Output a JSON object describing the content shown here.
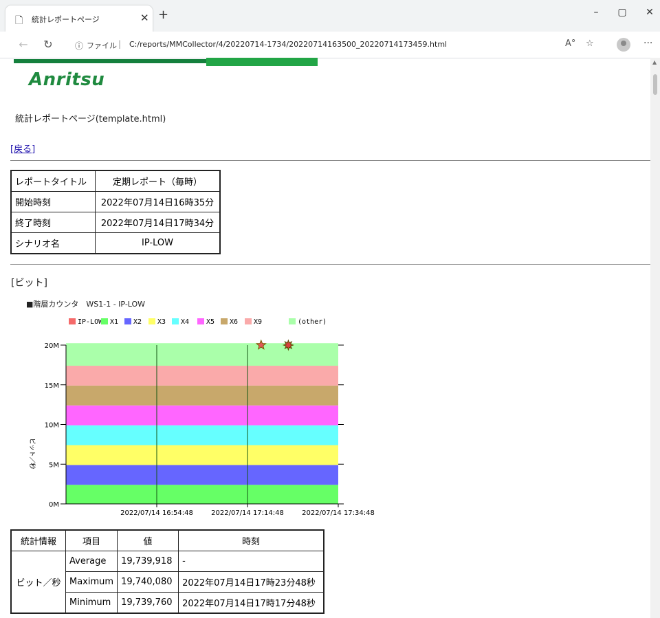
{
  "browser": {
    "tab_title": "統計レポートページ",
    "url_label": "ファイル",
    "url": "C:/reports/MMCollector/4/20220714-1734/20220714163500_20220714173459.html"
  },
  "page": {
    "logo": "Anritsu",
    "title": "統計レポートページ(template.html)",
    "back_link": "[戻る]"
  },
  "report_info": [
    {
      "label": "レポートタイトル",
      "value": "定期レポート（毎時）"
    },
    {
      "label": "開始時刻",
      "value": "2022年07月14日16時35分"
    },
    {
      "label": "終了時刻",
      "value": "2022年07月14日17時34分"
    },
    {
      "label": "シナリオ名",
      "value": "IP-LOW"
    }
  ],
  "section_title": "[ビット]",
  "chart_heading": "■階層カウンタ　WS1-1 - IP-LOW",
  "chart_data": {
    "type": "area",
    "stacked": true,
    "ylabel": "ビット／秒",
    "ylim": [
      0,
      20000000
    ],
    "yticks": [
      "0M",
      "5M",
      "10M",
      "15M",
      "20M"
    ],
    "xticks": [
      "2022/07/14 16:54:48",
      "2022/07/14 17:14:48",
      "2022/07/14 17:34:48"
    ],
    "series": [
      {
        "name": "IP-LOW",
        "color": "#f56a6a",
        "values": [
          0,
          0
        ]
      },
      {
        "name": "X1",
        "color": "#66ff66",
        "values": [
          2400000,
          2400000
        ]
      },
      {
        "name": "X2",
        "color": "#6666ff",
        "values": [
          2500000,
          2500000
        ]
      },
      {
        "name": "X3",
        "color": "#ffff66",
        "values": [
          2500000,
          2500000
        ]
      },
      {
        "name": "X4",
        "color": "#66ffff",
        "values": [
          2500000,
          2500000
        ]
      },
      {
        "name": "X5",
        "color": "#ff66ff",
        "values": [
          2500000,
          2500000
        ]
      },
      {
        "name": "X6",
        "color": "#c8a86b",
        "values": [
          2500000,
          2500000
        ]
      },
      {
        "name": "X9",
        "color": "#faaaaa",
        "values": [
          2500000,
          2500000
        ]
      },
      {
        "name": "(other)",
        "color": "#aaffaa",
        "values": [
          2840000,
          2840000
        ]
      }
    ],
    "markers": [
      {
        "time": "2022/07/14 17:17:48",
        "kind": "minimum"
      },
      {
        "time": "2022/07/14 17:23:48",
        "kind": "maximum"
      }
    ]
  },
  "stats": {
    "headers": [
      "統計情報",
      "項目",
      "値",
      "時刻"
    ],
    "group_label": "ビット／秒",
    "rows": [
      {
        "item": "Average",
        "value": "19,739,918",
        "time": "-"
      },
      {
        "item": "Maximum",
        "value": "19,740,080",
        "time": "2022年07月14日17時23分48秒"
      },
      {
        "item": "Minimum",
        "value": "19,739,760",
        "time": "2022年07月14日17時17分48秒"
      }
    ]
  }
}
